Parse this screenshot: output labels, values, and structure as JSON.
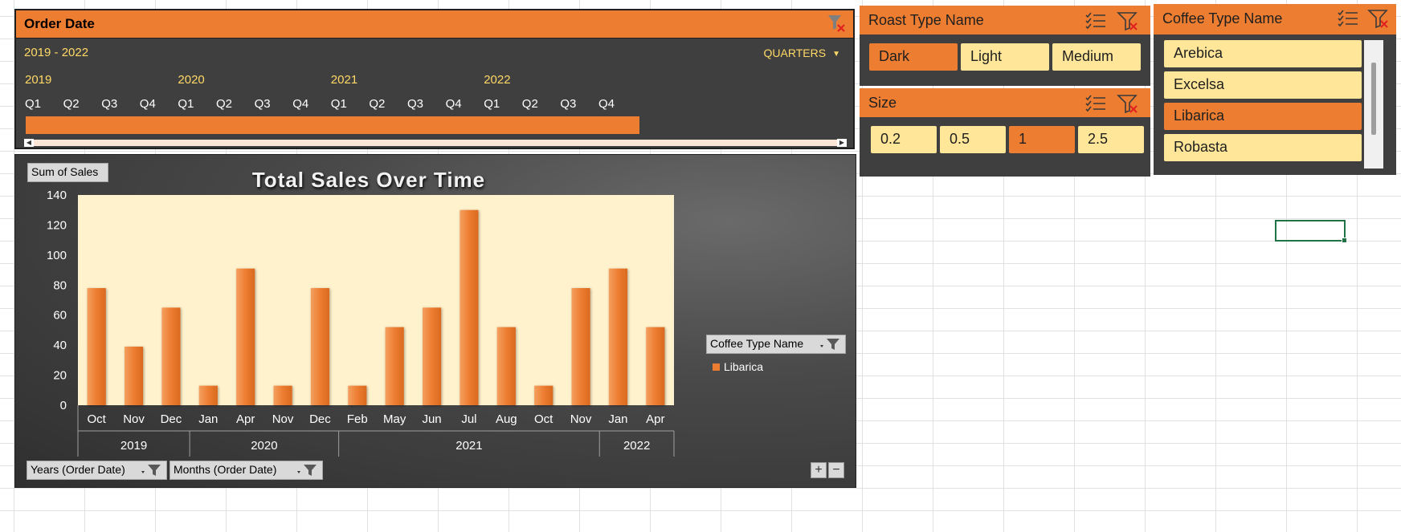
{
  "timeline": {
    "title": "Order Date",
    "range": "2019 - 2022",
    "level": "QUARTERS",
    "years": [
      "2019",
      "2020",
      "2021",
      "2022"
    ],
    "quarters": [
      "Q1",
      "Q2",
      "Q3",
      "Q4",
      "Q1",
      "Q2",
      "Q3",
      "Q4",
      "Q1",
      "Q2",
      "Q3",
      "Q4",
      "Q1",
      "Q2",
      "Q3",
      "Q4"
    ],
    "selected_fraction": 0.73
  },
  "roast_slicer": {
    "title": "Roast Type Name",
    "items": [
      {
        "label": "Dark",
        "selected": true
      },
      {
        "label": "Light",
        "selected": false
      },
      {
        "label": "Medium",
        "selected": false
      }
    ]
  },
  "size_slicer": {
    "title": "Size",
    "items": [
      {
        "label": "0.2",
        "selected": false
      },
      {
        "label": "0.5",
        "selected": false
      },
      {
        "label": "1",
        "selected": true
      },
      {
        "label": "2.5",
        "selected": false
      }
    ]
  },
  "coffee_slicer": {
    "title": "Coffee Type Name",
    "items": [
      {
        "label": "Arebica",
        "selected": false
      },
      {
        "label": "Excelsa",
        "selected": false
      },
      {
        "label": "Libarica",
        "selected": true
      },
      {
        "label": "Robasta",
        "selected": false
      }
    ]
  },
  "pivot_chart": {
    "value_field": "Sum of Sales",
    "legend_field": "Coffee Type Name",
    "axis_fields": [
      "Years (Order Date)",
      "Months (Order Date)"
    ],
    "expand_label": "+",
    "collapse_label": "−"
  },
  "colors": {
    "accent": "#ed7d31",
    "slicer_unselected": "#ffe699",
    "plot_area": "#fff2cc",
    "panel_dark": "#3f3f3f",
    "cell_selection": "#217346"
  },
  "chart_data": {
    "type": "bar",
    "title": "Total Sales Over Time",
    "xlabel": "",
    "ylabel": "",
    "ylim": [
      0,
      140
    ],
    "yticks": [
      0,
      20,
      40,
      60,
      80,
      100,
      120,
      140
    ],
    "grid": false,
    "legend_position": "right",
    "categories": [
      "Oct",
      "Nov",
      "Dec",
      "Jan",
      "Apr",
      "Nov",
      "Dec",
      "Feb",
      "May",
      "Jun",
      "Jul",
      "Aug",
      "Oct",
      "Nov",
      "Jan",
      "Apr"
    ],
    "groups": [
      {
        "label": "2019",
        "count": 3
      },
      {
        "label": "2020",
        "count": 4
      },
      {
        "label": "2021",
        "count": 7
      },
      {
        "label": "2022",
        "count": 2
      }
    ],
    "series": [
      {
        "name": "Libarica",
        "values": [
          78,
          39,
          65,
          13,
          91,
          13,
          78,
          13,
          52,
          65,
          130,
          52,
          13,
          78,
          91,
          52
        ]
      }
    ]
  }
}
